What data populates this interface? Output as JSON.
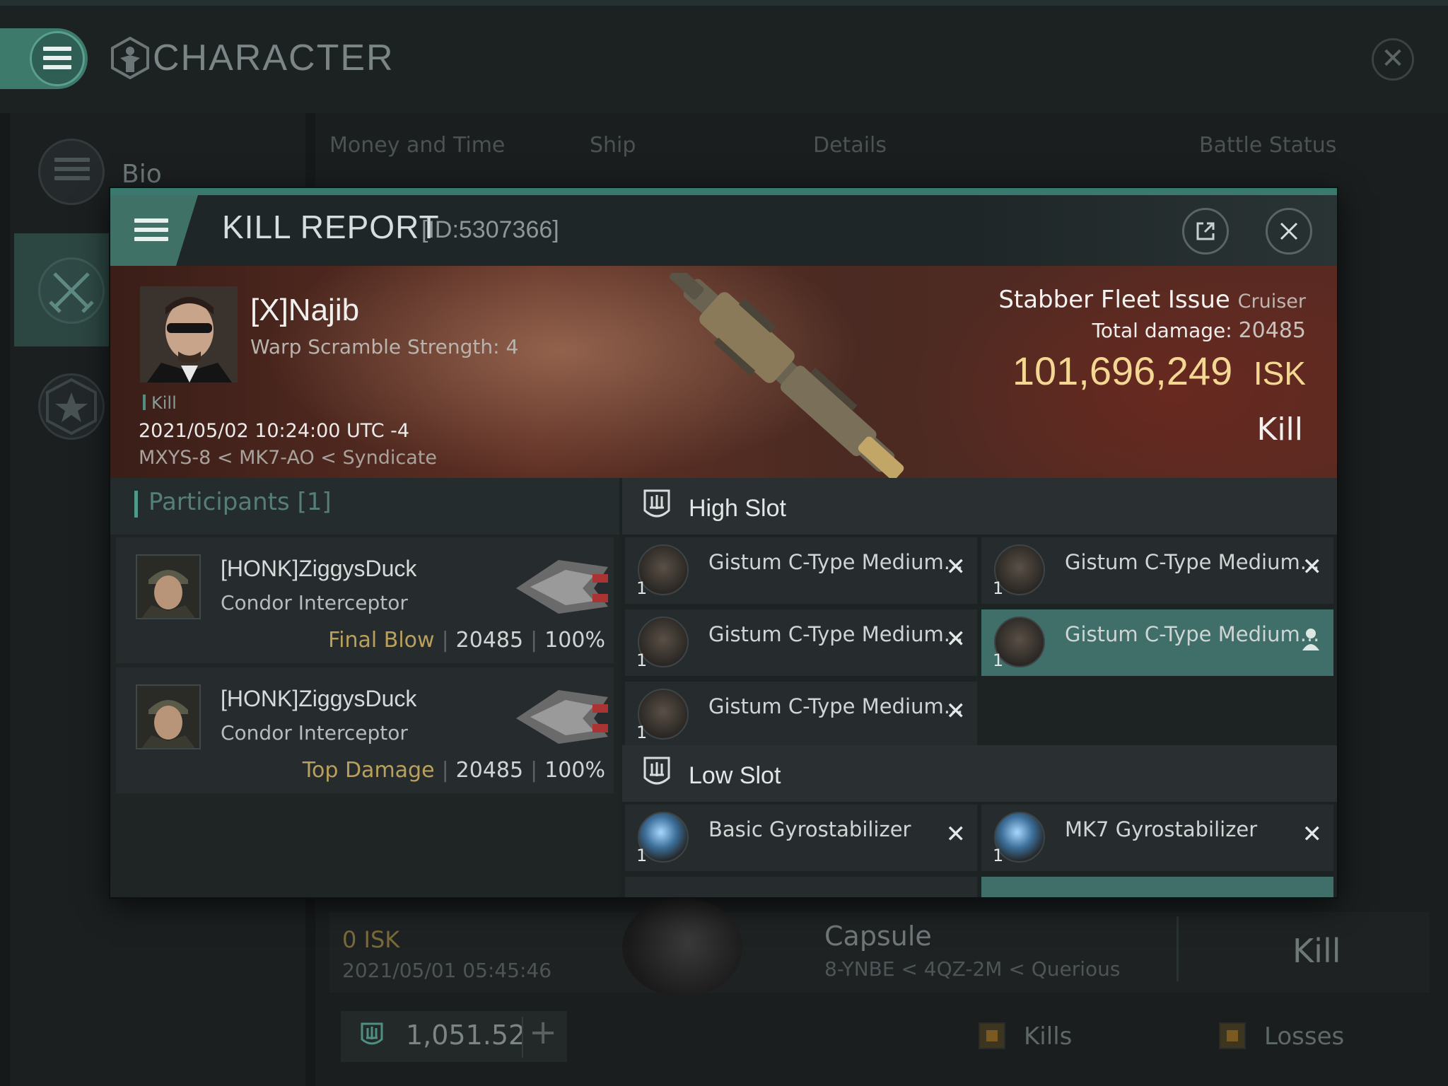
{
  "app": {
    "title": "CHARACTER"
  },
  "sidebar": {
    "bio_label": "Bio"
  },
  "tabs": [
    "Money and Time",
    "Ship",
    "Details",
    "Battle Status"
  ],
  "background_entry": {
    "isk": "0  ISK",
    "date": "2021/05/01  05:45:46",
    "ship": "Capsule",
    "location": "8-YNBE < 4QZ-2M < Querious",
    "result": "Kill"
  },
  "footer": {
    "wallet_value": "1,051.52",
    "legend": [
      "Kills",
      "Losses"
    ]
  },
  "kill_report": {
    "title": "KILL REPORT",
    "id": "[ID:5307366]",
    "victim": {
      "name": "[X]Najib",
      "subtitle": "Warp Scramble Strength: 4",
      "tag": "Kill",
      "datetime": "2021/05/02 10:24:00 UTC -4",
      "location": "MXYS-8 < MK7-AO < Syndicate",
      "ship": "Stabber Fleet Issue",
      "ship_class": "Cruiser",
      "total_damage_label": "Total damage:",
      "total_damage": "20485",
      "isk_value": "101,696,249",
      "isk_unit": "ISK",
      "result": "Kill"
    },
    "participants": {
      "title": "Participants",
      "count": "[1]",
      "rows": [
        {
          "name": "[HONK]ZiggysDuck",
          "ship": "Condor Interceptor",
          "role": "Final Blow",
          "damage": "20485",
          "percent": "100%"
        },
        {
          "name": "[HONK]ZiggysDuck",
          "ship": "Condor Interceptor",
          "role": "Top Damage",
          "damage": "20485",
          "percent": "100%"
        }
      ]
    },
    "high_slot": {
      "title": "High Slot",
      "modules": [
        {
          "name": "Gistum C-Type Medium...",
          "qty": "1"
        },
        {
          "name": "Gistum C-Type Medium...",
          "qty": "1"
        },
        {
          "name": "Gistum C-Type Medium...",
          "qty": "1"
        },
        {
          "name": "Gistum C-Type Medium...",
          "qty": "1"
        },
        {
          "name": "Gistum C-Type Medium...",
          "qty": "1"
        }
      ]
    },
    "low_slot": {
      "title": "Low Slot",
      "modules": [
        {
          "name": "Basic Gyrostabilizer",
          "qty": "1"
        },
        {
          "name": "MK7 Gyrostabilizer",
          "qty": "1"
        }
      ]
    }
  },
  "colors": {
    "accent": "#3f7166",
    "isk_gold": "#f3d792",
    "role_gold": "#b9a05c",
    "highlight_row": "#3f6f68"
  }
}
